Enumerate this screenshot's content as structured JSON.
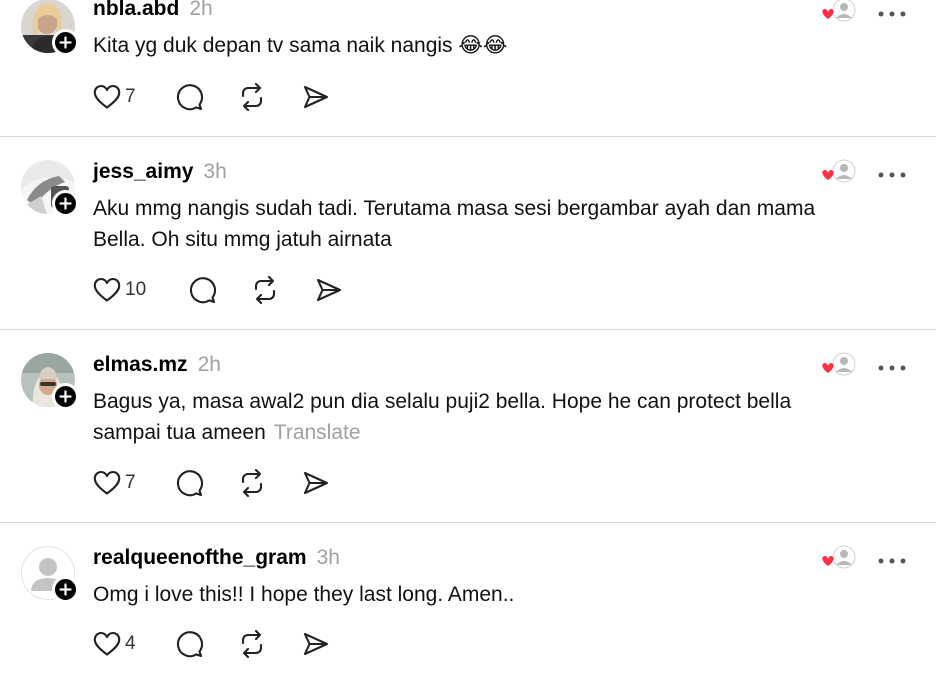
{
  "posts": [
    {
      "username": "nbla.abd",
      "time": "2h",
      "lines": [
        "Kita yg duk depan tv sama naik nangis 😂😂"
      ],
      "translate": "",
      "likes": "7",
      "avatar": "photo"
    },
    {
      "username": "jess_aimy",
      "time": "3h",
      "lines": [
        "Aku mmg nangis sudah tadi. Terutama masa sesi bergambar ayah dan mama",
        "Bella. Oh situ mmg jatuh airnata"
      ],
      "translate": "",
      "likes": "10",
      "avatar": "photo"
    },
    {
      "username": "elmas.mz",
      "time": "2h",
      "lines": [
        "Bagus ya, masa awal2 pun dia selalu puji2 bella. Hope he can protect bella",
        "sampai tua ameen"
      ],
      "translate": "Translate",
      "likes": "7",
      "avatar": "photo"
    },
    {
      "username": "realqueenofthe_gram",
      "time": "3h",
      "lines": [
        "Omg i love this!! I hope they last long. Amen.."
      ],
      "translate": "",
      "likes": "4",
      "avatar": "default-person"
    }
  ],
  "icons": {
    "like": "heart-outline-icon",
    "reply": "comment-bubble-icon",
    "repost": "repost-arrows-icon",
    "share": "send-icon",
    "more": "more-dots-icon",
    "liked_by": "liked-by-author-icon",
    "follow": "plus-icon"
  },
  "colors": {
    "heart_red": "#ff3040",
    "secondary_text": "#a0a0a0",
    "divider": "#d8d8d8"
  }
}
